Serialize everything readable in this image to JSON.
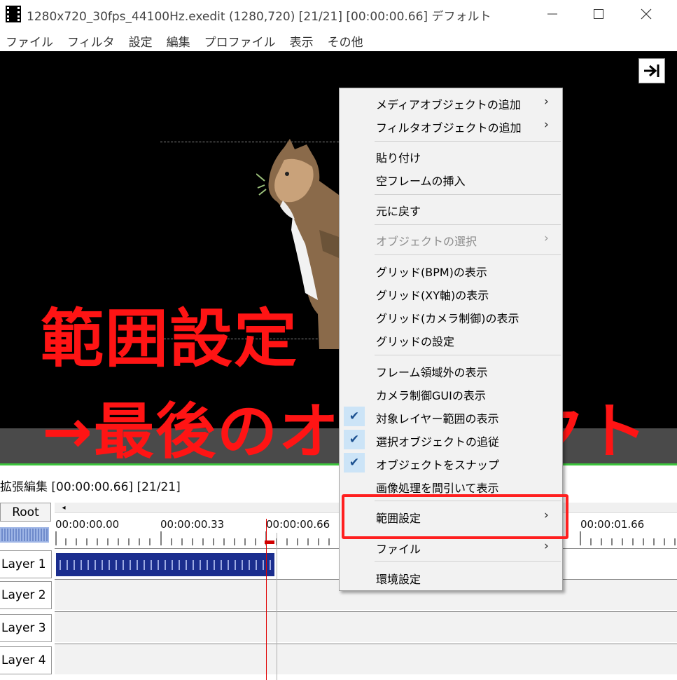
{
  "window": {
    "title": "1280x720_30fps_44100Hz.exedit (1280,720)  [21/21] [00:00:00.66]  デフォルト"
  },
  "menubar": {
    "items": [
      "ファイル",
      "フィルタ",
      "設定",
      "編集",
      "プロファイル",
      "表示",
      "その他"
    ]
  },
  "timeline": {
    "header": "拡張編集 [00:00:00.66] [21/21]",
    "root_label": "Root",
    "timestamps": [
      "00:00:00.00",
      "00:00:00.33",
      "00:00:00.66",
      "00:00:01.66"
    ],
    "layers": [
      "Layer 1",
      "Layer 2",
      "Layer 3",
      "Layer 4"
    ]
  },
  "context_menu": {
    "items": [
      {
        "label": "メディアオブジェクトの追加",
        "submenu": true
      },
      {
        "label": "フィルタオブジェクトの追加",
        "submenu": true
      },
      {
        "label": "貼り付け"
      },
      {
        "label": "空フレームの挿入"
      },
      {
        "label": "元に戻す"
      },
      {
        "label": "オブジェクトの選択",
        "submenu": true,
        "disabled": true
      },
      {
        "label": "グリッド(BPM)の表示"
      },
      {
        "label": "グリッド(XY軸)の表示"
      },
      {
        "label": "グリッド(カメラ制御)の表示"
      },
      {
        "label": "グリッドの設定"
      },
      {
        "label": "フレーム領域外の表示"
      },
      {
        "label": "カメラ制御GUIの表示"
      },
      {
        "label": "対象レイヤー範囲の表示",
        "checked": true
      },
      {
        "label": "選択オブジェクトの追従",
        "checked": true
      },
      {
        "label": "オブジェクトをスナップ",
        "checked": true
      },
      {
        "label": "画像処理を間引いて表示"
      },
      {
        "label": "範囲設定",
        "submenu": true,
        "highlighted": true
      },
      {
        "label": "ファイル",
        "submenu": true
      },
      {
        "label": "環境設定"
      }
    ]
  },
  "annotation": {
    "line1": "範囲設定",
    "line2": "→最後のオブジェクト",
    "color": "#ff1414"
  },
  "icons": {
    "submenu_arrow": "›",
    "checkmark": "✔",
    "scroll_left": "◂"
  }
}
